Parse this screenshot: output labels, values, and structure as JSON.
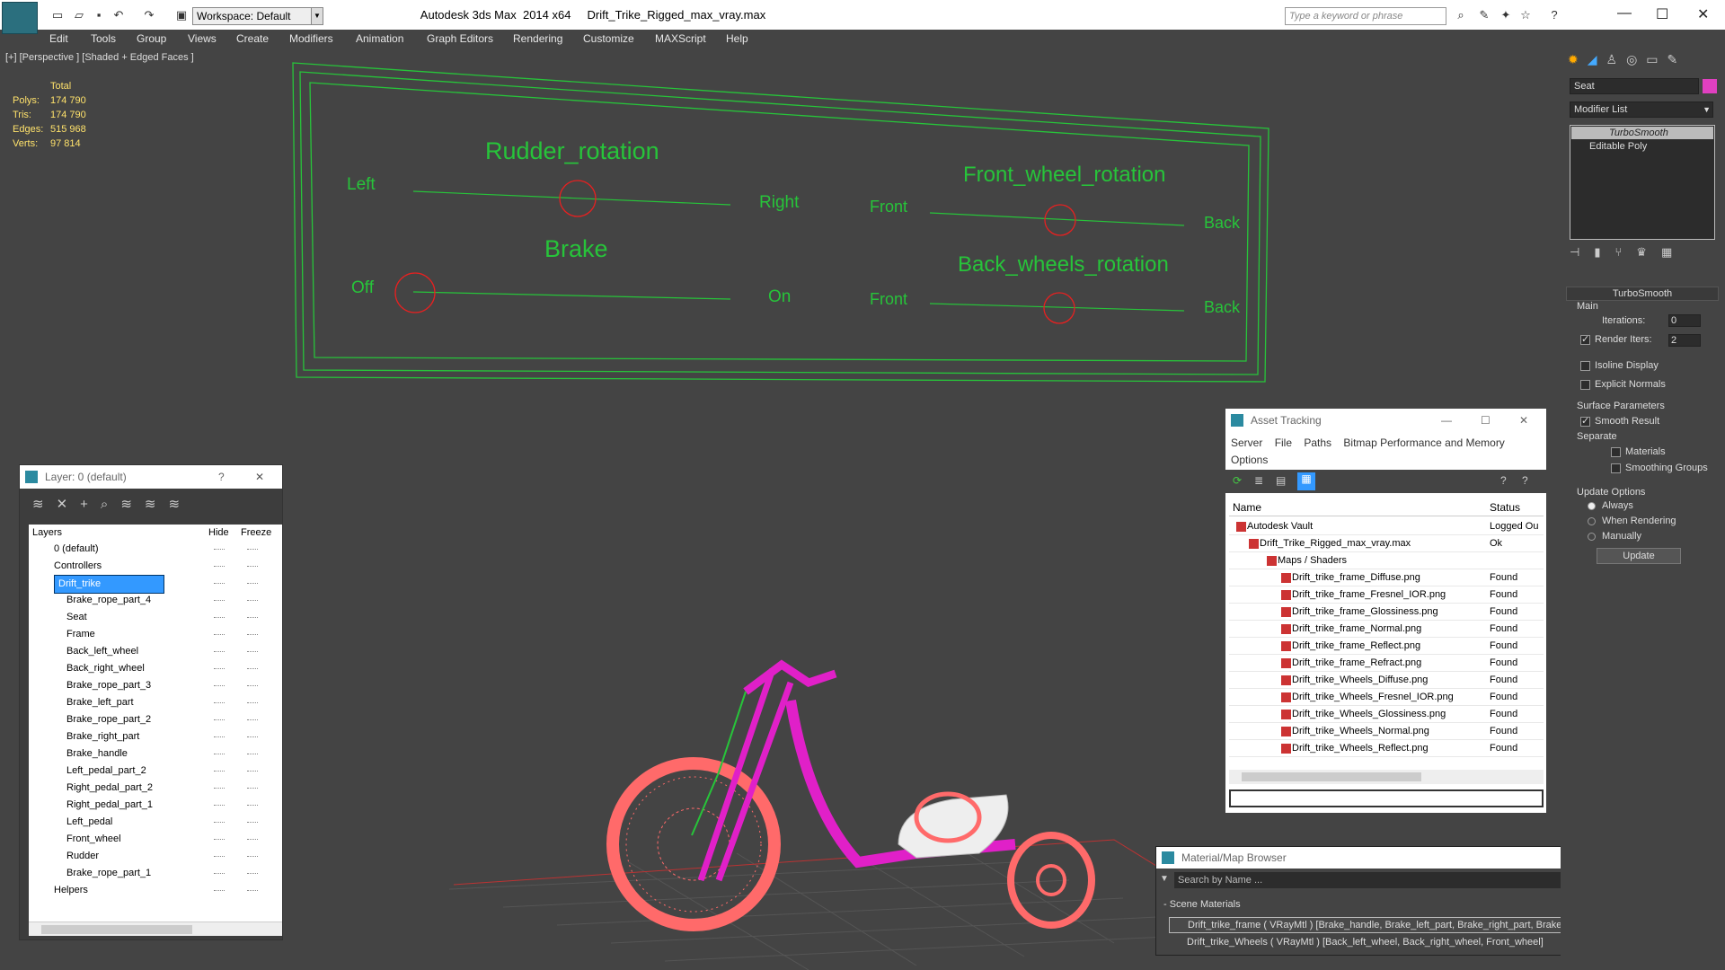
{
  "app": {
    "title": "Autodesk 3ds Max  2014 x64     Drift_Trike_Rigged_max_vray.max",
    "workspace": "Workspace: Default",
    "search_placeholder": "Type a keyword or phrase"
  },
  "menu": [
    "Edit",
    "Tools",
    "Group",
    "Views",
    "Create",
    "Modifiers",
    "Animation",
    "Graph Editors",
    "Rendering",
    "Customize",
    "MAXScript",
    "Help"
  ],
  "viewport": {
    "label": "[+] [Perspective ] [Shaded + Edged Faces ]",
    "stats_header": "Total",
    "stats": [
      {
        "k": "Polys:",
        "v": "174 790"
      },
      {
        "k": "Tris:",
        "v": "174 790"
      },
      {
        "k": "Edges:",
        "v": "515 968"
      },
      {
        "k": "Verts:",
        "v": "97 814"
      }
    ],
    "rig": {
      "rudder_title": "Rudder_rotation",
      "left": "Left",
      "right": "Right",
      "brake_title": "Brake",
      "off": "Off",
      "on": "On",
      "front_wheel_title": "Front_wheel_rotation",
      "front1": "Front",
      "back1": "Back",
      "back_wheels_title": "Back_wheels_rotation",
      "front2": "Front",
      "back2": "Back"
    }
  },
  "layers": {
    "title": "Layer: 0 (default)",
    "help": "?",
    "col_layers": "Layers",
    "col_hide": "Hide",
    "col_freeze": "Freeze",
    "rows": [
      {
        "name": "0 (default)",
        "level": 0
      },
      {
        "name": "Controllers",
        "level": 0
      },
      {
        "name": "Drift_trike",
        "level": 0,
        "selected": true
      },
      {
        "name": "Brake_rope_part_4",
        "level": 1
      },
      {
        "name": "Seat",
        "level": 1
      },
      {
        "name": "Frame",
        "level": 1
      },
      {
        "name": "Back_left_wheel",
        "level": 1
      },
      {
        "name": "Back_right_wheel",
        "level": 1
      },
      {
        "name": "Brake_rope_part_3",
        "level": 1
      },
      {
        "name": "Brake_left_part",
        "level": 1
      },
      {
        "name": "Brake_rope_part_2",
        "level": 1
      },
      {
        "name": "Brake_right_part",
        "level": 1
      },
      {
        "name": "Brake_handle",
        "level": 1
      },
      {
        "name": "Left_pedal_part_2",
        "level": 1
      },
      {
        "name": "Right_pedal_part_2",
        "level": 1
      },
      {
        "name": "Right_pedal_part_1",
        "level": 1
      },
      {
        "name": "Left_pedal",
        "level": 1
      },
      {
        "name": "Front_wheel",
        "level": 1
      },
      {
        "name": "Rudder",
        "level": 1
      },
      {
        "name": "Brake_rope_part_1",
        "level": 1
      },
      {
        "name": "Helpers",
        "level": 0
      }
    ]
  },
  "asset": {
    "title": "Asset Tracking",
    "menu": [
      "Server",
      "File",
      "Paths",
      "Bitmap Performance and Memory"
    ],
    "menu2": "Options",
    "col_name": "Name",
    "col_status": "Status",
    "rows": [
      {
        "name": "Autodesk Vault",
        "status": "Logged Ou",
        "indent": 20
      },
      {
        "name": "Drift_Trike_Rigged_max_vray.max",
        "status": "Ok",
        "indent": 34
      },
      {
        "name": "Maps / Shaders",
        "status": "",
        "indent": 54
      },
      {
        "name": "Drift_trike_frame_Diffuse.png",
        "status": "Found",
        "indent": 70
      },
      {
        "name": "Drift_trike_frame_Fresnel_IOR.png",
        "status": "Found",
        "indent": 70
      },
      {
        "name": "Drift_trike_frame_Glossiness.png",
        "status": "Found",
        "indent": 70
      },
      {
        "name": "Drift_trike_frame_Normal.png",
        "status": "Found",
        "indent": 70
      },
      {
        "name": "Drift_trike_frame_Reflect.png",
        "status": "Found",
        "indent": 70
      },
      {
        "name": "Drift_trike_frame_Refract.png",
        "status": "Found",
        "indent": 70
      },
      {
        "name": "Drift_trike_Wheels_Diffuse.png",
        "status": "Found",
        "indent": 70
      },
      {
        "name": "Drift_trike_Wheels_Fresnel_IOR.png",
        "status": "Found",
        "indent": 70
      },
      {
        "name": "Drift_trike_Wheels_Glossiness.png",
        "status": "Found",
        "indent": 70
      },
      {
        "name": "Drift_trike_Wheels_Normal.png",
        "status": "Found",
        "indent": 70
      },
      {
        "name": "Drift_trike_Wheels_Reflect.png",
        "status": "Found",
        "indent": 70
      }
    ]
  },
  "matbrowser": {
    "title": "Material/Map Browser",
    "search_placeholder": "Search by Name ...",
    "section": "- Scene Materials",
    "items": [
      "Drift_trike_frame  ( VRayMtl ) [Brake_handle, Brake_left_part, Brake_right_part, Brake_rope_part_1, Brake...",
      "Drift_trike_Wheels  ( VRayMtl ) [Back_left_wheel, Back_right_wheel, Front_wheel]"
    ]
  },
  "cmd": {
    "object_name": "Seat",
    "modifier_list": "Modifier List",
    "stack": [
      "TurboSmooth",
      "Editable Poly"
    ],
    "rollout": "TurboSmooth",
    "main": "Main",
    "iterations_label": "Iterations:",
    "iterations": "0",
    "render_iters_label": "Render Iters:",
    "render_iters": "2",
    "isoline": "Isoline Display",
    "explicit": "Explicit Normals",
    "surface": "Surface Parameters",
    "smooth": "Smooth Result",
    "separate": "Separate",
    "materials": "Materials",
    "smoothing": "Smoothing Groups",
    "update_options": "Update Options",
    "always": "Always",
    "when_rendering": "When Rendering",
    "manually": "Manually",
    "update_btn": "Update"
  },
  "colors": {
    "rig_green": "#27c43a",
    "handle_red": "#e82020",
    "frame_magenta": "#e020c8",
    "wheel_red": "#ff6a6a",
    "stats_yellow": "#ffe26b",
    "selection_blue": "#3399ff"
  }
}
